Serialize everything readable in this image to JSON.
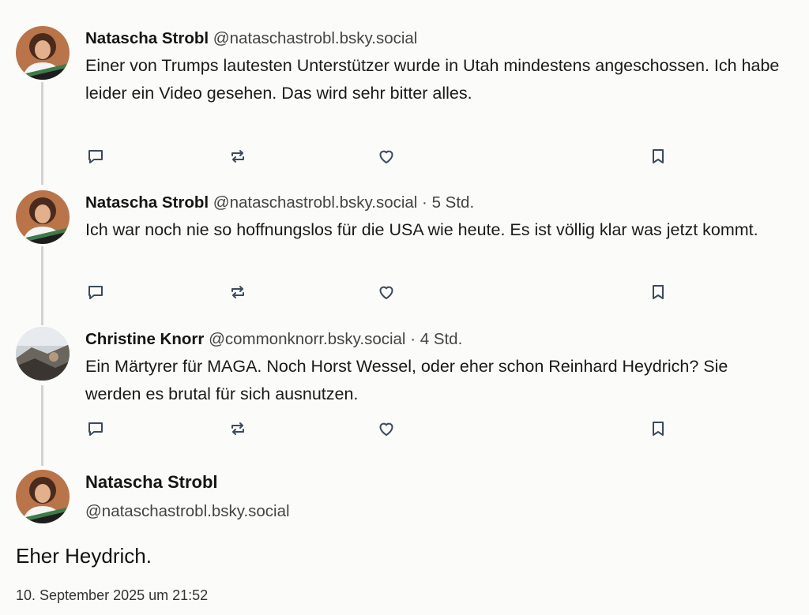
{
  "colors": {
    "background": "#fbfbf9",
    "thread_line": "#cfd3d8",
    "icon": "#3c4a5c",
    "avatar_green": "#3f7a4a"
  },
  "posts": [
    {
      "name": "Natascha Strobl",
      "handle": "@nataschastrobl.bsky.social",
      "meta": "",
      "text": "Einer von Trumps lautesten Unterstützer wurde in Utah mindestens angeschossen. Ich habe leider ein Video gesehen. Das wird sehr bitter alles.",
      "avatar": "natascha-avatar"
    },
    {
      "name": "Natascha Strobl",
      "handle": "@nataschastrobl.bsky.social",
      "meta": " · 5 Std.",
      "text": "Ich war noch nie so hoffnungslos für die USA wie heute. Es ist völlig klar was jetzt kommt.",
      "avatar": "natascha-avatar"
    },
    {
      "name": "Christine Knorr",
      "handle": "@commonknorr.bsky.social",
      "meta": " · 4 Std.",
      "text": "Ein Märtyrer für MAGA. Noch Horst Wessel, oder eher schon Reinhard Heydrich? Sie werden es brutal für sich ausnutzen.",
      "avatar": "christine-avatar"
    }
  ],
  "actions": {
    "reply": "reply-icon",
    "repost": "repost-icon",
    "like": "heart-icon",
    "bookmark": "bookmark-icon"
  },
  "main_post": {
    "name": "Natascha Strobl",
    "handle": "@nataschastrobl.bsky.social",
    "text": "Eher Heydrich.",
    "date": "10. September 2025 um 21:52"
  }
}
